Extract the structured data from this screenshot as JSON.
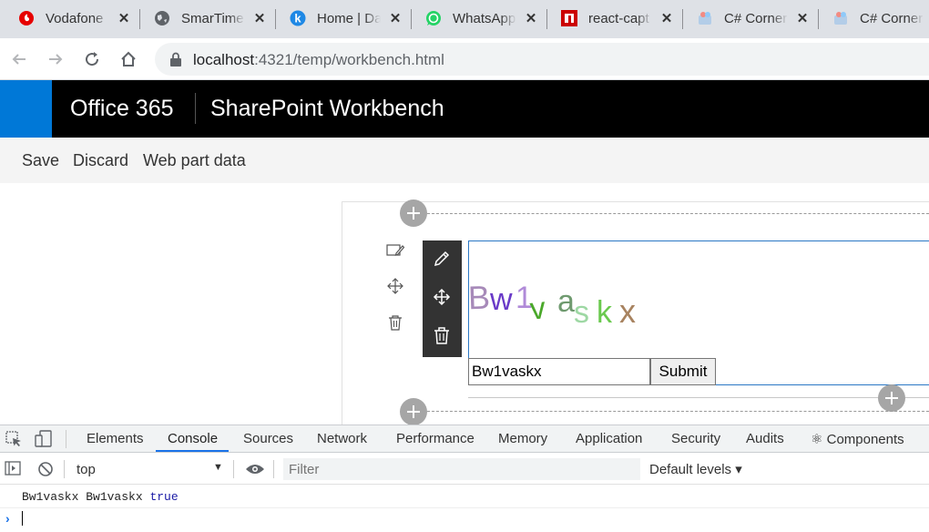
{
  "browser": {
    "tabs": [
      {
        "label": "Vodafone",
        "icon": "vodafone-icon"
      },
      {
        "label": "SmarTime",
        "icon": "globe-icon"
      },
      {
        "label": "Home | Da",
        "icon": "k-app-icon"
      },
      {
        "label": "WhatsApp",
        "icon": "whatsapp-icon"
      },
      {
        "label": "react-capt",
        "icon": "npm-icon"
      },
      {
        "label": "C# Corner",
        "icon": "csharp-corner-icon"
      },
      {
        "label": "C# Corner",
        "icon": "csharp-corner-icon"
      }
    ],
    "close_glyph": "✕",
    "url_host": "localhost",
    "url_rest": ":4321/temp/workbench.html"
  },
  "sharepoint": {
    "brand": "Office 365",
    "app_title": "SharePoint Workbench",
    "accent": "#0078d7",
    "commands": {
      "save": "Save",
      "discard": "Discard",
      "web_part_data": "Web part data"
    }
  },
  "webpart": {
    "captcha_chars": [
      "B",
      "w",
      "1",
      "v",
      "a",
      "s",
      "k",
      "x"
    ],
    "input_value": "Bw1vaskx",
    "submit_label": "Submit"
  },
  "devtools": {
    "tabs": [
      "Elements",
      "Console",
      "Sources",
      "Network",
      "Performance",
      "Memory",
      "Application",
      "Security",
      "Audits",
      "⚛ Components"
    ],
    "active_tab": "Console",
    "context": "top",
    "filter_placeholder": "Filter",
    "levels": "Default levels ▾",
    "log_text": "Bw1vaskx Bw1vaskx ",
    "log_bool": "true",
    "prompt": "›"
  }
}
